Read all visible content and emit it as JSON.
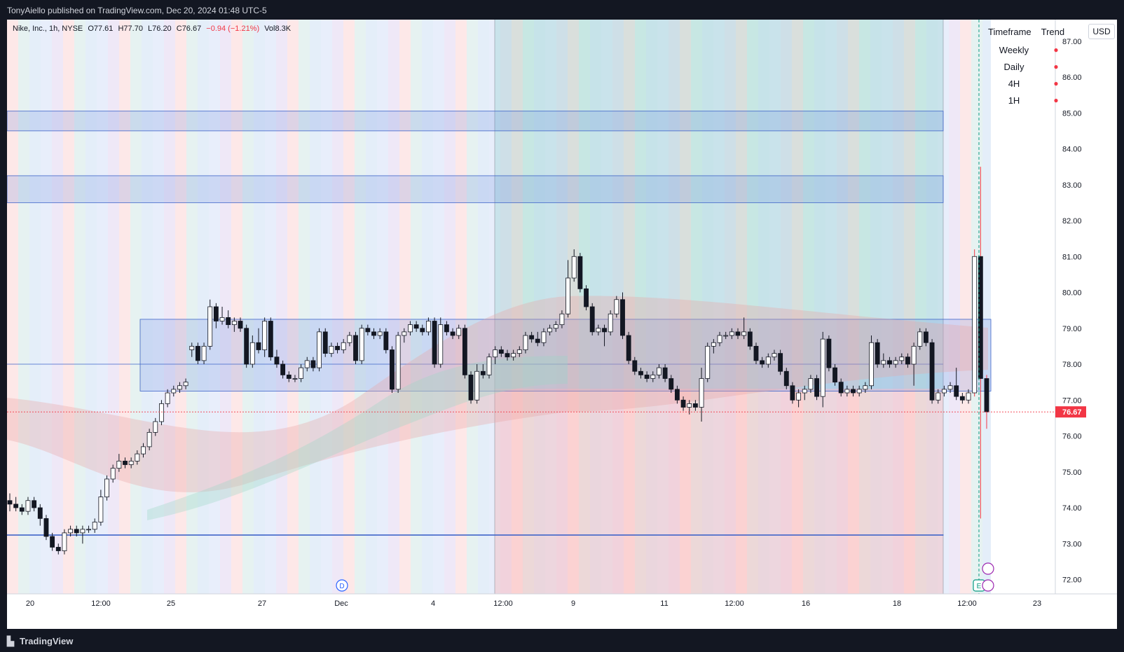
{
  "header": {
    "publisher": "TonyAiello published on TradingView.com, Dec 20, 2024 01:48 UTC-5"
  },
  "legend": {
    "symbol": "Nike, Inc., 1h, NYSE",
    "open": "O77.61",
    "high": "H77.70",
    "low": "L76.20",
    "close": "C76.67",
    "change": "−0.94 (−1.21%)",
    "volume": "Vol8.3K"
  },
  "currency": "USD",
  "trend_table": {
    "col_timeframe": "Timeframe",
    "col_trend": "Trend",
    "rows": [
      {
        "timeframe": "Weekly",
        "trend": "●"
      },
      {
        "timeframe": "Daily",
        "trend": "●"
      },
      {
        "timeframe": "4H",
        "trend": "●"
      },
      {
        "timeframe": "1H",
        "trend": "●"
      }
    ],
    "bearish_color": "#f23645"
  },
  "footer": {
    "brand": "TradingView"
  },
  "markers": {
    "dividend": "D",
    "earnings": "E"
  },
  "chart_data": {
    "type": "candlestick",
    "title": "Nike, Inc., 1h, NYSE",
    "ylim": [
      71.6,
      87.6
    ],
    "y_ticks": [
      "72.00",
      "73.00",
      "74.00",
      "75.00",
      "76.00",
      "77.00",
      "78.00",
      "79.00",
      "80.00",
      "81.00",
      "82.00",
      "83.00",
      "84.00",
      "85.00",
      "86.00",
      "87.00"
    ],
    "x_ticks": [
      "20",
      "12:00",
      "25",
      "27",
      "Dec",
      "4",
      "12:00",
      "9",
      "11",
      "12:00",
      "16",
      "18",
      "12:00",
      "23"
    ],
    "last_price": "76.67",
    "last_price_color": "#f23645",
    "up_color": "#131722",
    "down_color": "#131722",
    "zones": [
      {
        "low": 84.5,
        "high": 85.05
      },
      {
        "low": 82.5,
        "high": 83.25
      },
      {
        "low": 77.25,
        "high": 79.25
      },
      {
        "low": 73.25,
        "high": 73.25
      }
    ],
    "candles": [
      [
        74.2,
        74.4,
        73.9,
        74.1
      ],
      [
        74.1,
        74.3,
        73.9,
        74.0
      ],
      [
        74.0,
        74.1,
        73.8,
        73.9
      ],
      [
        73.9,
        74.3,
        73.8,
        74.2
      ],
      [
        74.2,
        74.3,
        73.9,
        74.0
      ],
      [
        74.0,
        74.1,
        73.5,
        73.7
      ],
      [
        73.7,
        73.8,
        73.1,
        73.2
      ],
      [
        73.2,
        73.3,
        72.8,
        72.9
      ],
      [
        72.9,
        73.0,
        72.7,
        72.8
      ],
      [
        72.8,
        73.4,
        72.7,
        73.3
      ],
      [
        73.3,
        73.5,
        73.2,
        73.4
      ],
      [
        73.4,
        73.5,
        73.2,
        73.3
      ],
      [
        73.3,
        73.5,
        73.0,
        73.4
      ],
      [
        73.4,
        73.5,
        73.3,
        73.4
      ],
      [
        73.4,
        73.7,
        73.3,
        73.6
      ],
      [
        73.6,
        74.5,
        73.5,
        74.3
      ],
      [
        74.3,
        74.9,
        74.2,
        74.8
      ],
      [
        74.8,
        75.2,
        74.7,
        75.1
      ],
      [
        75.1,
        75.5,
        75.0,
        75.3
      ],
      [
        75.3,
        75.4,
        75.1,
        75.2
      ],
      [
        75.2,
        75.4,
        75.1,
        75.3
      ],
      [
        75.3,
        75.6,
        75.2,
        75.5
      ],
      [
        75.5,
        75.8,
        75.4,
        75.7
      ],
      [
        75.7,
        76.2,
        75.6,
        76.1
      ],
      [
        76.1,
        76.5,
        76.0,
        76.4
      ],
      [
        76.4,
        77.0,
        76.3,
        76.9
      ],
      [
        76.9,
        77.3,
        76.8,
        77.2
      ],
      [
        77.2,
        77.4,
        77.1,
        77.3
      ],
      [
        77.3,
        77.5,
        77.2,
        77.4
      ],
      [
        77.4,
        77.6,
        77.3,
        77.5
      ],
      [
        78.4,
        78.6,
        78.2,
        78.5
      ],
      [
        78.5,
        78.6,
        78.0,
        78.1
      ],
      [
        78.1,
        78.6,
        78.0,
        78.5
      ],
      [
        78.5,
        79.8,
        78.4,
        79.6
      ],
      [
        79.6,
        79.7,
        79.0,
        79.2
      ],
      [
        79.2,
        79.6,
        79.1,
        79.3
      ],
      [
        79.3,
        79.5,
        79.0,
        79.1
      ],
      [
        79.1,
        79.3,
        78.9,
        79.2
      ],
      [
        79.2,
        79.3,
        78.9,
        79.0
      ],
      [
        79.0,
        79.1,
        77.9,
        78.0
      ],
      [
        78.0,
        78.8,
        77.9,
        78.6
      ],
      [
        78.6,
        79.0,
        78.3,
        78.4
      ],
      [
        78.4,
        79.3,
        78.2,
        79.2
      ],
      [
        79.2,
        79.3,
        78.1,
        78.2
      ],
      [
        78.2,
        78.4,
        77.9,
        78.0
      ],
      [
        78.0,
        78.1,
        77.6,
        77.7
      ],
      [
        77.7,
        77.8,
        77.5,
        77.6
      ],
      [
        77.6,
        77.7,
        77.5,
        77.6
      ],
      [
        77.6,
        78.0,
        77.5,
        77.9
      ],
      [
        77.9,
        78.2,
        77.8,
        78.1
      ],
      [
        78.1,
        78.2,
        77.8,
        77.9
      ],
      [
        77.9,
        79.0,
        77.8,
        78.9
      ],
      [
        78.9,
        79.0,
        78.2,
        78.3
      ],
      [
        78.3,
        78.6,
        78.2,
        78.5
      ],
      [
        78.5,
        78.6,
        78.3,
        78.4
      ],
      [
        78.4,
        78.7,
        78.3,
        78.6
      ],
      [
        78.6,
        78.9,
        78.5,
        78.8
      ],
      [
        78.8,
        78.9,
        78.0,
        78.1
      ],
      [
        78.1,
        79.1,
        78.0,
        79.0
      ],
      [
        79.0,
        79.1,
        78.8,
        78.9
      ],
      [
        78.9,
        79.0,
        78.7,
        78.8
      ],
      [
        78.8,
        79.0,
        78.7,
        78.9
      ],
      [
        78.9,
        79.0,
        78.3,
        78.4
      ],
      [
        78.4,
        78.5,
        77.2,
        77.3
      ],
      [
        77.3,
        78.9,
        77.2,
        78.8
      ],
      [
        78.8,
        79.0,
        78.6,
        78.9
      ],
      [
        78.9,
        79.2,
        78.8,
        79.1
      ],
      [
        79.1,
        79.2,
        78.9,
        79.0
      ],
      [
        79.0,
        79.1,
        78.8,
        78.9
      ],
      [
        78.9,
        79.3,
        78.8,
        79.2
      ],
      [
        79.2,
        79.3,
        77.9,
        78.0
      ],
      [
        78.0,
        79.3,
        77.9,
        79.1
      ],
      [
        79.1,
        79.2,
        78.8,
        78.9
      ],
      [
        78.9,
        79.0,
        78.7,
        78.8
      ],
      [
        78.8,
        79.1,
        78.7,
        79.0
      ],
      [
        79.0,
        79.1,
        77.6,
        77.7
      ],
      [
        77.7,
        77.8,
        76.9,
        77.0
      ],
      [
        77.0,
        78.0,
        76.9,
        77.8
      ],
      [
        77.8,
        78.0,
        77.6,
        77.7
      ],
      [
        77.7,
        78.3,
        77.6,
        78.2
      ],
      [
        78.2,
        78.5,
        78.0,
        78.4
      ],
      [
        78.4,
        78.5,
        78.2,
        78.3
      ],
      [
        78.3,
        78.4,
        78.1,
        78.2
      ],
      [
        78.2,
        78.4,
        78.1,
        78.3
      ],
      [
        78.3,
        78.5,
        78.2,
        78.4
      ],
      [
        78.4,
        78.9,
        78.3,
        78.8
      ],
      [
        78.8,
        78.9,
        78.6,
        78.7
      ],
      [
        78.7,
        78.9,
        78.5,
        78.6
      ],
      [
        78.6,
        79.0,
        78.5,
        78.9
      ],
      [
        78.9,
        79.1,
        78.8,
        79.0
      ],
      [
        79.0,
        79.2,
        78.9,
        79.1
      ],
      [
        79.1,
        79.5,
        79.0,
        79.4
      ],
      [
        79.4,
        80.9,
        79.3,
        80.4
      ],
      [
        80.4,
        81.2,
        80.3,
        81.0
      ],
      [
        81.0,
        81.1,
        80.0,
        80.1
      ],
      [
        80.1,
        80.2,
        79.5,
        79.6
      ],
      [
        79.6,
        79.7,
        78.8,
        78.9
      ],
      [
        78.9,
        79.1,
        78.8,
        79.0
      ],
      [
        79.0,
        79.1,
        78.5,
        78.9
      ],
      [
        78.9,
        79.5,
        78.8,
        79.4
      ],
      [
        79.4,
        79.9,
        79.3,
        79.8
      ],
      [
        79.8,
        80.0,
        78.7,
        78.8
      ],
      [
        78.8,
        78.9,
        78.0,
        78.1
      ],
      [
        78.1,
        78.2,
        77.7,
        77.8
      ],
      [
        77.8,
        77.9,
        77.6,
        77.7
      ],
      [
        77.7,
        77.8,
        77.5,
        77.6
      ],
      [
        77.6,
        77.8,
        77.5,
        77.7
      ],
      [
        77.7,
        78.0,
        77.6,
        77.9
      ],
      [
        77.9,
        78.0,
        77.5,
        77.6
      ],
      [
        77.6,
        77.7,
        77.2,
        77.3
      ],
      [
        77.3,
        77.4,
        76.9,
        77.0
      ],
      [
        77.0,
        77.1,
        76.7,
        76.8
      ],
      [
        76.8,
        77.0,
        76.6,
        76.9
      ],
      [
        76.9,
        77.0,
        76.7,
        76.8
      ],
      [
        76.8,
        77.9,
        76.4,
        77.6
      ],
      [
        77.6,
        78.6,
        77.5,
        78.5
      ],
      [
        78.5,
        78.7,
        78.3,
        78.6
      ],
      [
        78.6,
        78.9,
        78.5,
        78.8
      ],
      [
        78.8,
        78.9,
        78.7,
        78.8
      ],
      [
        78.8,
        79.0,
        78.7,
        78.9
      ],
      [
        78.9,
        79.0,
        78.7,
        78.8
      ],
      [
        78.8,
        79.3,
        78.7,
        78.9
      ],
      [
        78.9,
        79.0,
        78.4,
        78.5
      ],
      [
        78.5,
        78.6,
        78.0,
        78.1
      ],
      [
        78.1,
        78.2,
        77.9,
        78.0
      ],
      [
        78.0,
        78.3,
        77.9,
        78.2
      ],
      [
        78.2,
        78.4,
        78.1,
        78.3
      ],
      [
        78.3,
        78.4,
        77.7,
        77.8
      ],
      [
        77.8,
        77.9,
        77.3,
        77.4
      ],
      [
        77.4,
        77.5,
        76.9,
        77.0
      ],
      [
        77.0,
        77.3,
        76.8,
        77.2
      ],
      [
        77.2,
        77.4,
        77.0,
        77.3
      ],
      [
        77.3,
        77.7,
        77.2,
        77.6
      ],
      [
        77.6,
        77.7,
        77.0,
        77.1
      ],
      [
        77.1,
        78.9,
        76.8,
        78.7
      ],
      [
        78.7,
        78.8,
        77.8,
        77.9
      ],
      [
        77.9,
        78.0,
        77.4,
        77.5
      ],
      [
        77.5,
        77.6,
        77.1,
        77.2
      ],
      [
        77.2,
        77.4,
        77.1,
        77.3
      ],
      [
        77.3,
        77.4,
        77.1,
        77.2
      ],
      [
        77.2,
        77.4,
        77.1,
        77.3
      ],
      [
        77.3,
        77.5,
        77.2,
        77.4
      ],
      [
        77.4,
        78.8,
        77.3,
        78.6
      ],
      [
        78.6,
        78.7,
        77.9,
        78.0
      ],
      [
        78.0,
        78.3,
        77.9,
        78.1
      ],
      [
        78.1,
        78.2,
        77.9,
        78.0
      ],
      [
        78.0,
        78.2,
        77.9,
        78.1
      ],
      [
        78.1,
        78.3,
        78.0,
        78.2
      ],
      [
        78.2,
        78.3,
        77.9,
        78.0
      ],
      [
        78.0,
        78.6,
        77.4,
        78.5
      ],
      [
        78.5,
        79.0,
        78.4,
        78.9
      ],
      [
        78.9,
        79.0,
        78.5,
        78.6
      ],
      [
        78.6,
        78.7,
        76.9,
        77.0
      ],
      [
        77.0,
        77.3,
        76.9,
        77.2
      ],
      [
        77.2,
        77.4,
        77.1,
        77.3
      ],
      [
        77.3,
        77.5,
        77.2,
        77.4
      ],
      [
        77.4,
        77.9,
        77.0,
        77.1
      ],
      [
        77.1,
        77.2,
        76.9,
        77.0
      ],
      [
        77.0,
        77.3,
        76.9,
        77.2
      ],
      [
        77.2,
        81.2,
        77.1,
        81.0
      ],
      [
        81.0,
        83.5,
        73.7,
        77.6
      ],
      [
        77.6,
        77.7,
        76.2,
        76.67
      ]
    ]
  }
}
